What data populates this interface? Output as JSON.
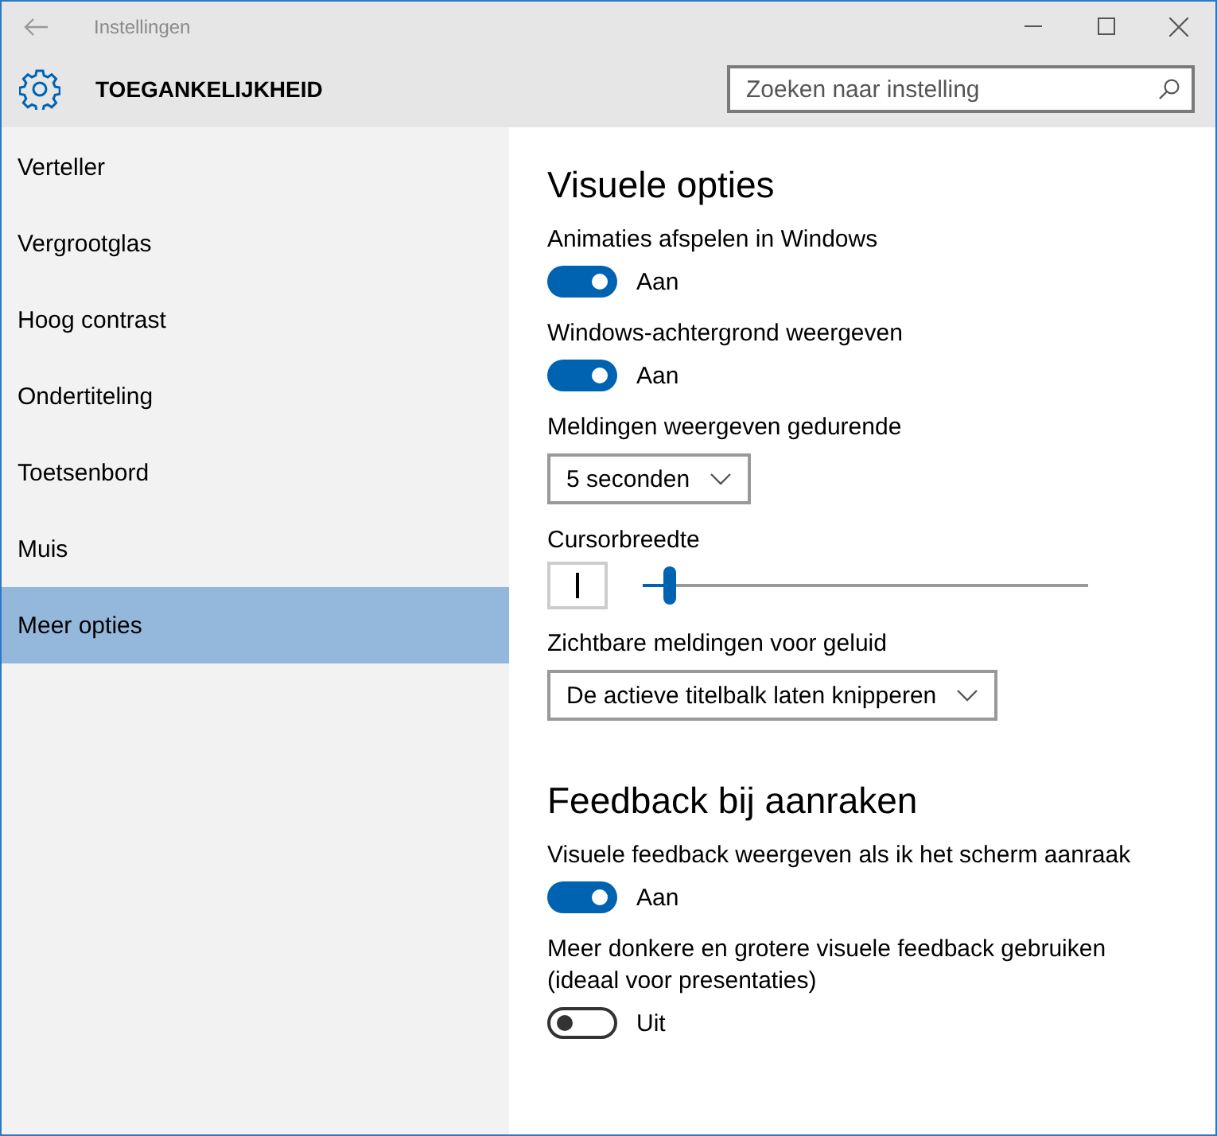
{
  "window": {
    "title": "Instellingen"
  },
  "header": {
    "title": "TOEGANKELIJKHEID",
    "search": {
      "placeholder": "Zoeken naar instelling"
    }
  },
  "sidebar": {
    "items": [
      {
        "label": "Verteller",
        "selected": false
      },
      {
        "label": "Vergrootglas",
        "selected": false
      },
      {
        "label": "Hoog contrast",
        "selected": false
      },
      {
        "label": "Ondertiteling",
        "selected": false
      },
      {
        "label": "Toetsenbord",
        "selected": false
      },
      {
        "label": "Muis",
        "selected": false
      },
      {
        "label": "Meer opties",
        "selected": true
      }
    ]
  },
  "sections": [
    {
      "title": "Visuele opties",
      "settings": [
        {
          "kind": "toggle",
          "label": "Animaties afspelen in Windows",
          "on": true,
          "state_text": "Aan"
        },
        {
          "kind": "toggle",
          "label": "Windows-achtergrond weergeven",
          "on": true,
          "state_text": "Aan"
        },
        {
          "kind": "dropdown",
          "label": "Meldingen weergeven gedurende",
          "value": "5 seconden"
        },
        {
          "kind": "slider",
          "label": "Cursorbreedte",
          "level": 0.06
        },
        {
          "kind": "dropdown",
          "label": "Zichtbare meldingen voor geluid",
          "value": "De actieve titelbalk laten knipperen"
        }
      ]
    },
    {
      "title": "Feedback bij aanraken",
      "settings": [
        {
          "kind": "toggle",
          "label": "Visuele feedback weergeven als ik het scherm aanraak",
          "on": true,
          "state_text": "Aan"
        },
        {
          "kind": "toggle",
          "label": "Meer donkere en grotere visuele feedback gebruiken (ideaal voor presentaties)",
          "on": false,
          "state_text": "Uit"
        }
      ]
    }
  ]
}
